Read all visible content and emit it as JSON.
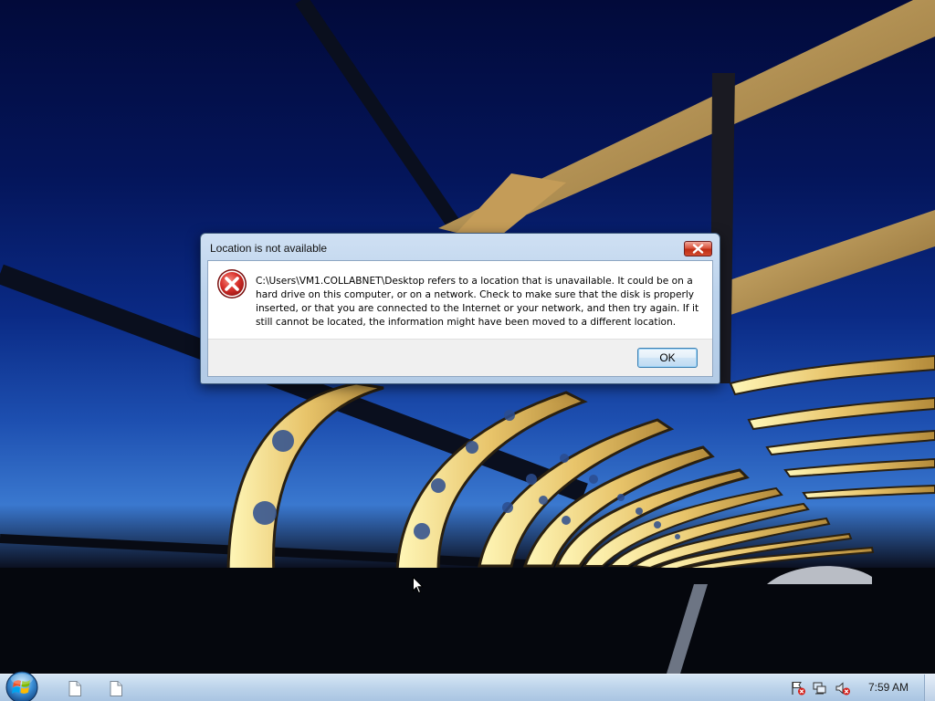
{
  "dialog": {
    "title": "Location is not available",
    "message": "C:\\Users\\VM1.COLLABNET\\Desktop refers to a location that is unavailable. It could be on a hard drive on this computer, or on a network. Check to make sure that the disk is properly inserted, or that you are connected to the Internet or your network, and then try again. If it still cannot be located, the information might have been moved to a different location.",
    "ok_label": "OK",
    "icon": "error-icon",
    "close_icon": "close-icon"
  },
  "taskbar": {
    "start_icon": "windows-start-orb-icon",
    "buttons": [
      {
        "icon": "document-icon"
      },
      {
        "icon": "document-icon"
      }
    ],
    "tray_icons": [
      "action-center-flag-icon",
      "network-icon",
      "volume-muted-icon"
    ],
    "clock": "7:59 AM"
  },
  "colors": {
    "sky_dark": "#020a3a",
    "sky_light": "#3a78cf",
    "arch_gold": "#e8c46a",
    "taskbar": "#bcd3ea",
    "error_red": "#c8272a"
  }
}
